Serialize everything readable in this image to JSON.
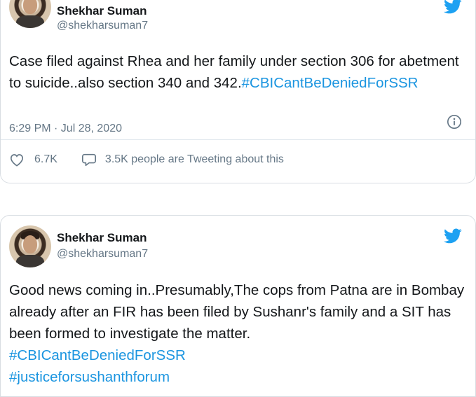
{
  "tweets": [
    {
      "author": "Shekhar Suman",
      "handle": "@shekharsuman7",
      "text": "Case filed against Rhea and her family under section 306 for abetment to suicide..also section 340 and 342.",
      "hashtags": [
        "#CBICantBeDeniedForSSR"
      ],
      "timestamp": "6:29 PM · Jul 28, 2020",
      "likes": "6.7K",
      "replies_text": "3.5K people are Tweeting about this"
    },
    {
      "author": "Shekhar Suman",
      "handle": "@shekharsuman7",
      "text": "Good news coming in..Presumably,The cops from Patna are in Bombay already after an FIR has been filed by Sushanr's family and a SIT has been formed to investigate the matter.",
      "hashtags": [
        "#CBICantBeDeniedForSSR",
        "#justiceforsushanthforum"
      ]
    }
  ],
  "icons": {
    "brand": "twitter-bird-icon",
    "info": "info-icon",
    "like": "heart-icon",
    "reply": "speech-bubble-icon"
  },
  "colors": {
    "twitter_blue": "#1da1f2",
    "hashtag": "#1b95e0",
    "secondary_text": "#657786",
    "border": "#d8dde2"
  }
}
